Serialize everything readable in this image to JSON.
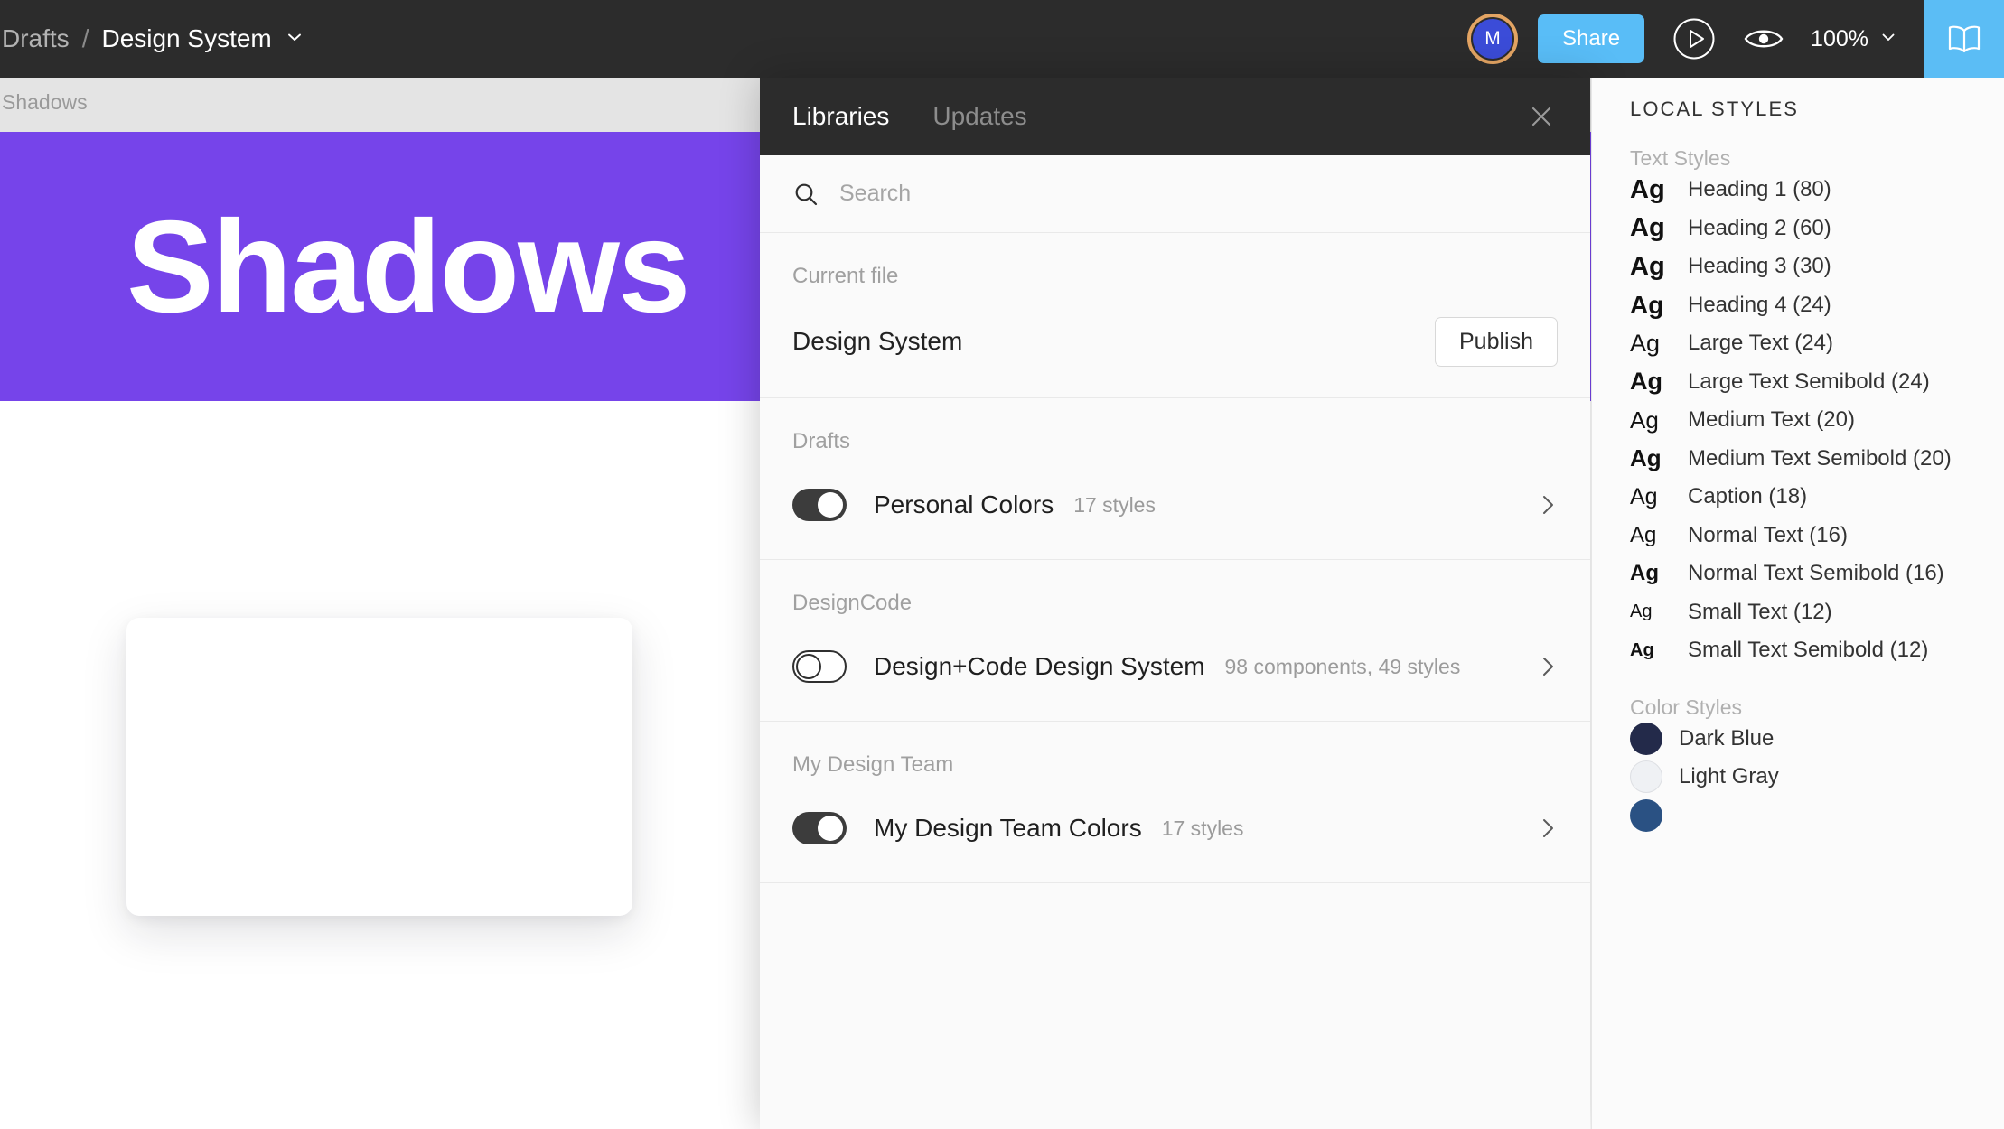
{
  "topbar": {
    "breadcrumb_root": "Drafts",
    "breadcrumb_separator": "/",
    "file_name": "Design System",
    "file_caret_icon": "chevron-down-icon",
    "avatar_initial": "M",
    "avatar_ring_color": "#e3a463",
    "avatar_bg_color": "#3b4cd8",
    "share_label": "Share",
    "share_color": "#59bdf7",
    "present_icon": "play-circle-icon",
    "view_icon": "eye-icon",
    "zoom_level": "100%",
    "zoom_caret_icon": "chevron-down-icon",
    "library_icon": "open-book-icon",
    "library_btn_color": "#5bbdf5",
    "bar_color": "#2c2c2c"
  },
  "canvas": {
    "frame_label": "Shadows",
    "frame_text": "Shadows",
    "frame_color": "#7644ea",
    "frame_label_bg": "#e4e4e4",
    "card_name": "empty-card"
  },
  "modal": {
    "tabs": [
      {
        "label": "Libraries",
        "active": true
      },
      {
        "label": "Updates",
        "active": false
      }
    ],
    "close_icon": "close-icon",
    "search": {
      "icon": "search-icon",
      "placeholder": "Search",
      "value": ""
    },
    "current_file": {
      "section_label": "Current file",
      "name": "Design System",
      "publish_label": "Publish"
    },
    "groups": [
      {
        "label": "Drafts",
        "libraries": [
          {
            "name": "Personal Colors",
            "meta": "17 styles",
            "enabled": true,
            "chevron_icon": "chevron-right-icon"
          }
        ]
      },
      {
        "label": "DesignCode",
        "libraries": [
          {
            "name": "Design+Code Design System",
            "meta": "98 components, 49 styles",
            "enabled": false,
            "chevron_icon": "chevron-right-icon"
          }
        ]
      },
      {
        "label": "My Design Team",
        "libraries": [
          {
            "name": "My Design Team Colors",
            "meta": "17 styles",
            "enabled": true,
            "chevron_icon": "chevron-right-icon"
          }
        ]
      }
    ]
  },
  "sidebar": {
    "panel_title": "LOCAL STYLES",
    "text_styles_label": "Text Styles",
    "text_styles": [
      {
        "preview": "Ag",
        "name": "Heading 1 (80)",
        "preview_size": 29,
        "preview_weight": "bold"
      },
      {
        "preview": "Ag",
        "name": "Heading 2 (60)",
        "preview_size": 29,
        "preview_weight": "bold"
      },
      {
        "preview": "Ag",
        "name": "Heading 3 (30)",
        "preview_size": 29,
        "preview_weight": "bold"
      },
      {
        "preview": "Ag",
        "name": "Heading 4 (24)",
        "preview_size": 28,
        "preview_weight": "bold"
      },
      {
        "preview": "Ag",
        "name": "Large Text (24)",
        "preview_size": 27,
        "preview_weight": "normal"
      },
      {
        "preview": "Ag",
        "name": "Large Text Semibold (24)",
        "preview_size": 27,
        "preview_weight": "bold"
      },
      {
        "preview": "Ag",
        "name": "Medium Text (20)",
        "preview_size": 26,
        "preview_weight": "normal"
      },
      {
        "preview": "Ag",
        "name": "Medium Text Semibold (20)",
        "preview_size": 26,
        "preview_weight": "bold"
      },
      {
        "preview": "Ag",
        "name": "Caption (18)",
        "preview_size": 25,
        "preview_weight": "normal"
      },
      {
        "preview": "Ag",
        "name": "Normal Text (16)",
        "preview_size": 24,
        "preview_weight": "normal"
      },
      {
        "preview": "Ag",
        "name": "Normal Text Semibold (16)",
        "preview_size": 24,
        "preview_weight": "bold"
      },
      {
        "preview": "Ag",
        "name": "Small Text (12)",
        "preview_size": 20,
        "preview_weight": "normal"
      },
      {
        "preview": "Ag",
        "name": "Small Text Semibold (12)",
        "preview_size": 20,
        "preview_weight": "bold"
      }
    ],
    "color_styles_label": "Color Styles",
    "color_styles": [
      {
        "name": "Dark Blue",
        "color": "#232a4a",
        "border": false
      },
      {
        "name": "Light Gray",
        "color": "#eff1f4",
        "border": true
      },
      {
        "name": "",
        "color": "#2a5183",
        "border": false
      }
    ]
  }
}
